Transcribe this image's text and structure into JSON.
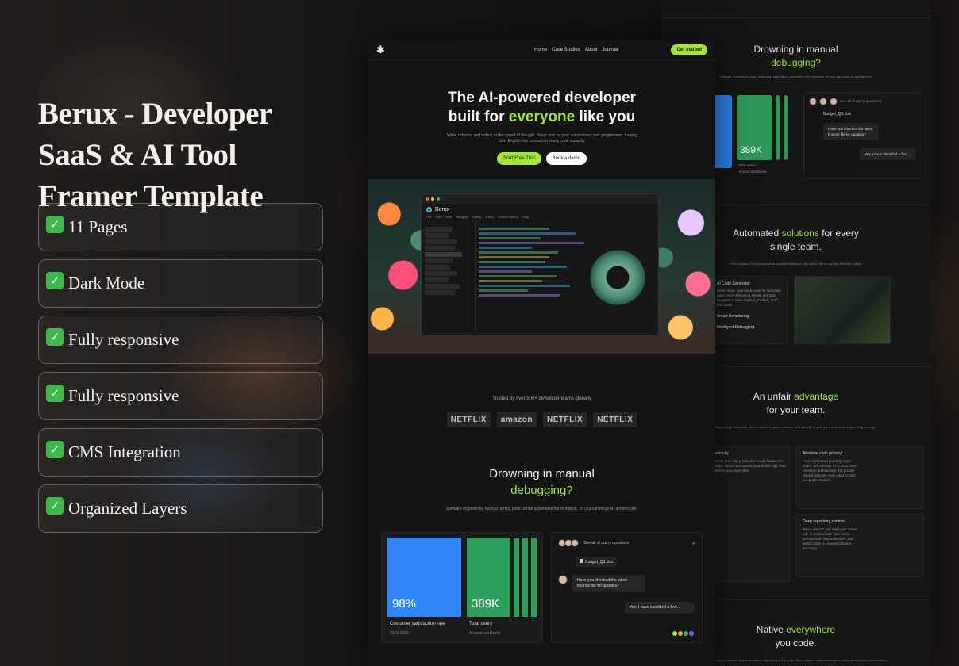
{
  "promo": {
    "title": "Berux - Developer SaaS & AI Tool Framer Template",
    "features": [
      {
        "label": "11 Pages"
      },
      {
        "label": "Dark Mode"
      },
      {
        "label": "Fully responsive"
      },
      {
        "label": "Fully responsive"
      },
      {
        "label": "CMS Integration"
      },
      {
        "label": "Organized Layers"
      }
    ],
    "check_glyph": "✓"
  },
  "template": {
    "nav": {
      "logo_glyph": "✱",
      "links": [
        "Home",
        "Case Studies",
        "About",
        "Journal"
      ],
      "cta": "Get started"
    },
    "hero": {
      "line1": "The AI-powered developer",
      "line2_pre": "built for ",
      "line2_accent": "everyone",
      "line2_post": " like you",
      "subtitle": "Write, refactor, and debug at the speed of thought. Berux acts as your autonomous pair programmer, turning plain English into production-ready code instantly.",
      "primary_button": "Start Free Trial",
      "secondary_button": "Book a demo"
    },
    "ide": {
      "brand": "Berux",
      "menu": [
        "File",
        "Edit",
        "View",
        "Navigate",
        "Debug",
        "Editor",
        "Source control",
        "Help"
      ]
    },
    "trusted": {
      "text": "Trusted by over 500+ developer teams globally",
      "logos": [
        "NETFLIX",
        "amazon",
        "NETFLIX",
        "NETFLIX"
      ]
    },
    "problem": {
      "line1": "Drowning in manual",
      "line2_accent": "debugging?",
      "subtitle": "Software engineering faces a turning point. Berux automates the mundane, so you can focus on architecture."
    },
    "stats": [
      {
        "value": "98%",
        "label": "Customer satisfaction rate",
        "sub": "2023-2025"
      },
      {
        "value": "389K",
        "label": "Total users",
        "sub": "Around worldwide"
      }
    ],
    "chat": {
      "header": "See all of query questions",
      "file": "Budget_Q3.xlsx",
      "question": "Have you checked the latest finance file for updates?",
      "answer": "Yes, I have identified a few...",
      "plus": "+"
    }
  },
  "secondary": {
    "problem": {
      "line1": "Drowning in manual",
      "line2_accent": "debugging?",
      "subtitle": "Software engineering faces a turning point. Berux automates the mundane, so you can focus on architecture."
    },
    "stat": {
      "value": "389K",
      "label": "Total users",
      "sub": "Around worldwide"
    },
    "chat": {
      "header": "See all of query questions",
      "file": "Budget_Q3.xlsx",
      "question": "Have you checked the latest finance file for updates?",
      "answer": "Yes, I have identified a few..."
    },
    "solutions": {
      "line1_pre": "Automated ",
      "line1_accent": "solutions",
      "line1_post": " for every",
      "line2": "single team.",
      "subtitle": "From frontend UI components to complex database migrations, Berux handles the entire stack.",
      "items": [
        "AI Code Generator",
        "Smart Refactoring",
        "Intelligent Debugging"
      ],
      "item_desc": "Write clean, optimized code for websites, apps, and APIs using simple prompts. Supports React, Node.js, Python, PHP, and more."
    },
    "advantage": {
      "line1_pre": "An unfair ",
      "line1_accent": "advantage",
      "line2": "for your team.",
      "subtitle": "Stop writing boilerplate. Berux combines speed, context, and security to give you the ultimate engineering leverage.",
      "card1_title": "velocity.",
      "card1_text": "Write and ship productive ready features in days. Berux anticipates your entire logic flow before you even type.",
      "card2_title": "Absolute code privacy.",
      "card2_text": "Your intellectual property stays yours. We operate on a strict zero-retention architecture. No private repositories are ever used to train our public models.",
      "card3_title": "Deep repository context.",
      "card3_text": "Berux doesn't just read your active tab. It understands your entire architecture, dependencies, and global state to provide pinpoint accuracy."
    },
    "native": {
      "line1_pre": "Native ",
      "line1_accent": "everywhere",
      "line2": "you code.",
      "subtitle": "Whether you're refactoring a local repo or deploying to the edge, Berux stays in sync across your entire development environment."
    }
  },
  "colors": {
    "accent": "#a3e635",
    "blue": "#2f86f6",
    "green": "#2e9e5b",
    "check": "#3fb94b"
  }
}
